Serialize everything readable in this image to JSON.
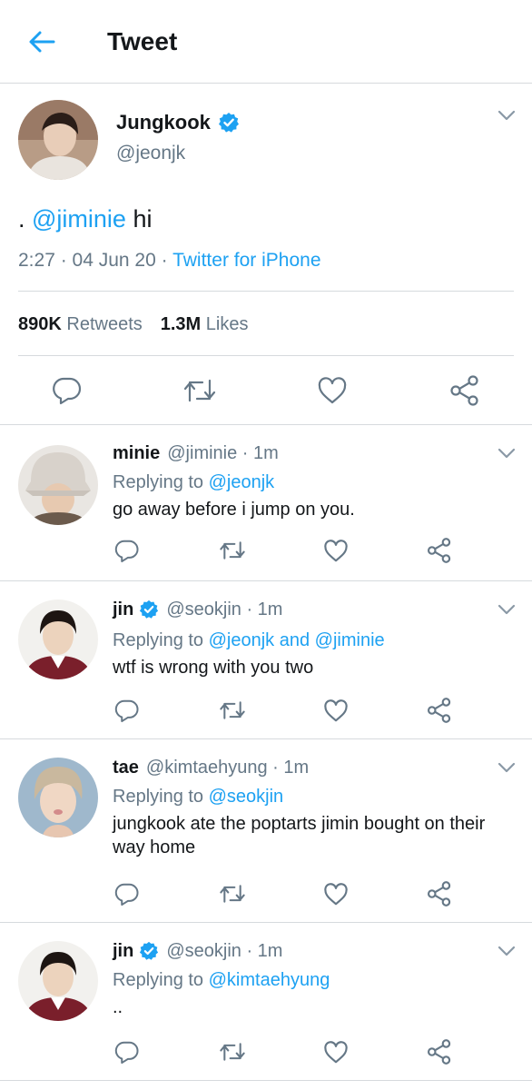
{
  "header": {
    "title": "Tweet"
  },
  "main_tweet": {
    "name": "Jungkook",
    "handle": "@jeonjk",
    "text_prefix": ". ",
    "mention": "@jiminie",
    "text_suffix": " hi",
    "time": "2:27",
    "sep1": " · ",
    "date": "04 Jun 20",
    "sep2": " · ",
    "source": "Twitter for iPhone",
    "retweets_count": "890K",
    "retweets_label": "Retweets",
    "likes_count": "1.3M",
    "likes_label": "Likes"
  },
  "replies": [
    {
      "name": "minie",
      "handle": "@jiminie · 1m",
      "verified": false,
      "replying_prefix": "Replying to ",
      "replying_to": "@jeonjk",
      "text": "go away before i jump on you."
    },
    {
      "name": "jin",
      "handle": "@seokjin · 1m",
      "verified": true,
      "replying_prefix": "Replying to ",
      "replying_to": "@jeonjk and @jiminie",
      "text": "wtf is wrong with you two"
    },
    {
      "name": "tae",
      "handle": "@kimtaehyung · 1m",
      "verified": false,
      "replying_prefix": "Replying to ",
      "replying_to": "@seokjin",
      "text": "jungkook ate the poptarts jimin bought on their way home"
    },
    {
      "name": "jin",
      "handle": "@seokjin · 1m",
      "verified": true,
      "replying_prefix": "Replying to ",
      "replying_to": "@kimtaehyung",
      "text": ".."
    }
  ],
  "icons": {
    "back": "back-arrow-icon",
    "verified": "verified-badge-icon",
    "chevron": "chevron-down-icon",
    "reply": "reply-icon",
    "retweet": "retweet-icon",
    "like": "like-icon",
    "share": "share-icon"
  },
  "colors": {
    "accent": "#1da1f2",
    "secondary_text": "#657786",
    "divider": "#d6dadd",
    "icon": "#657786"
  }
}
